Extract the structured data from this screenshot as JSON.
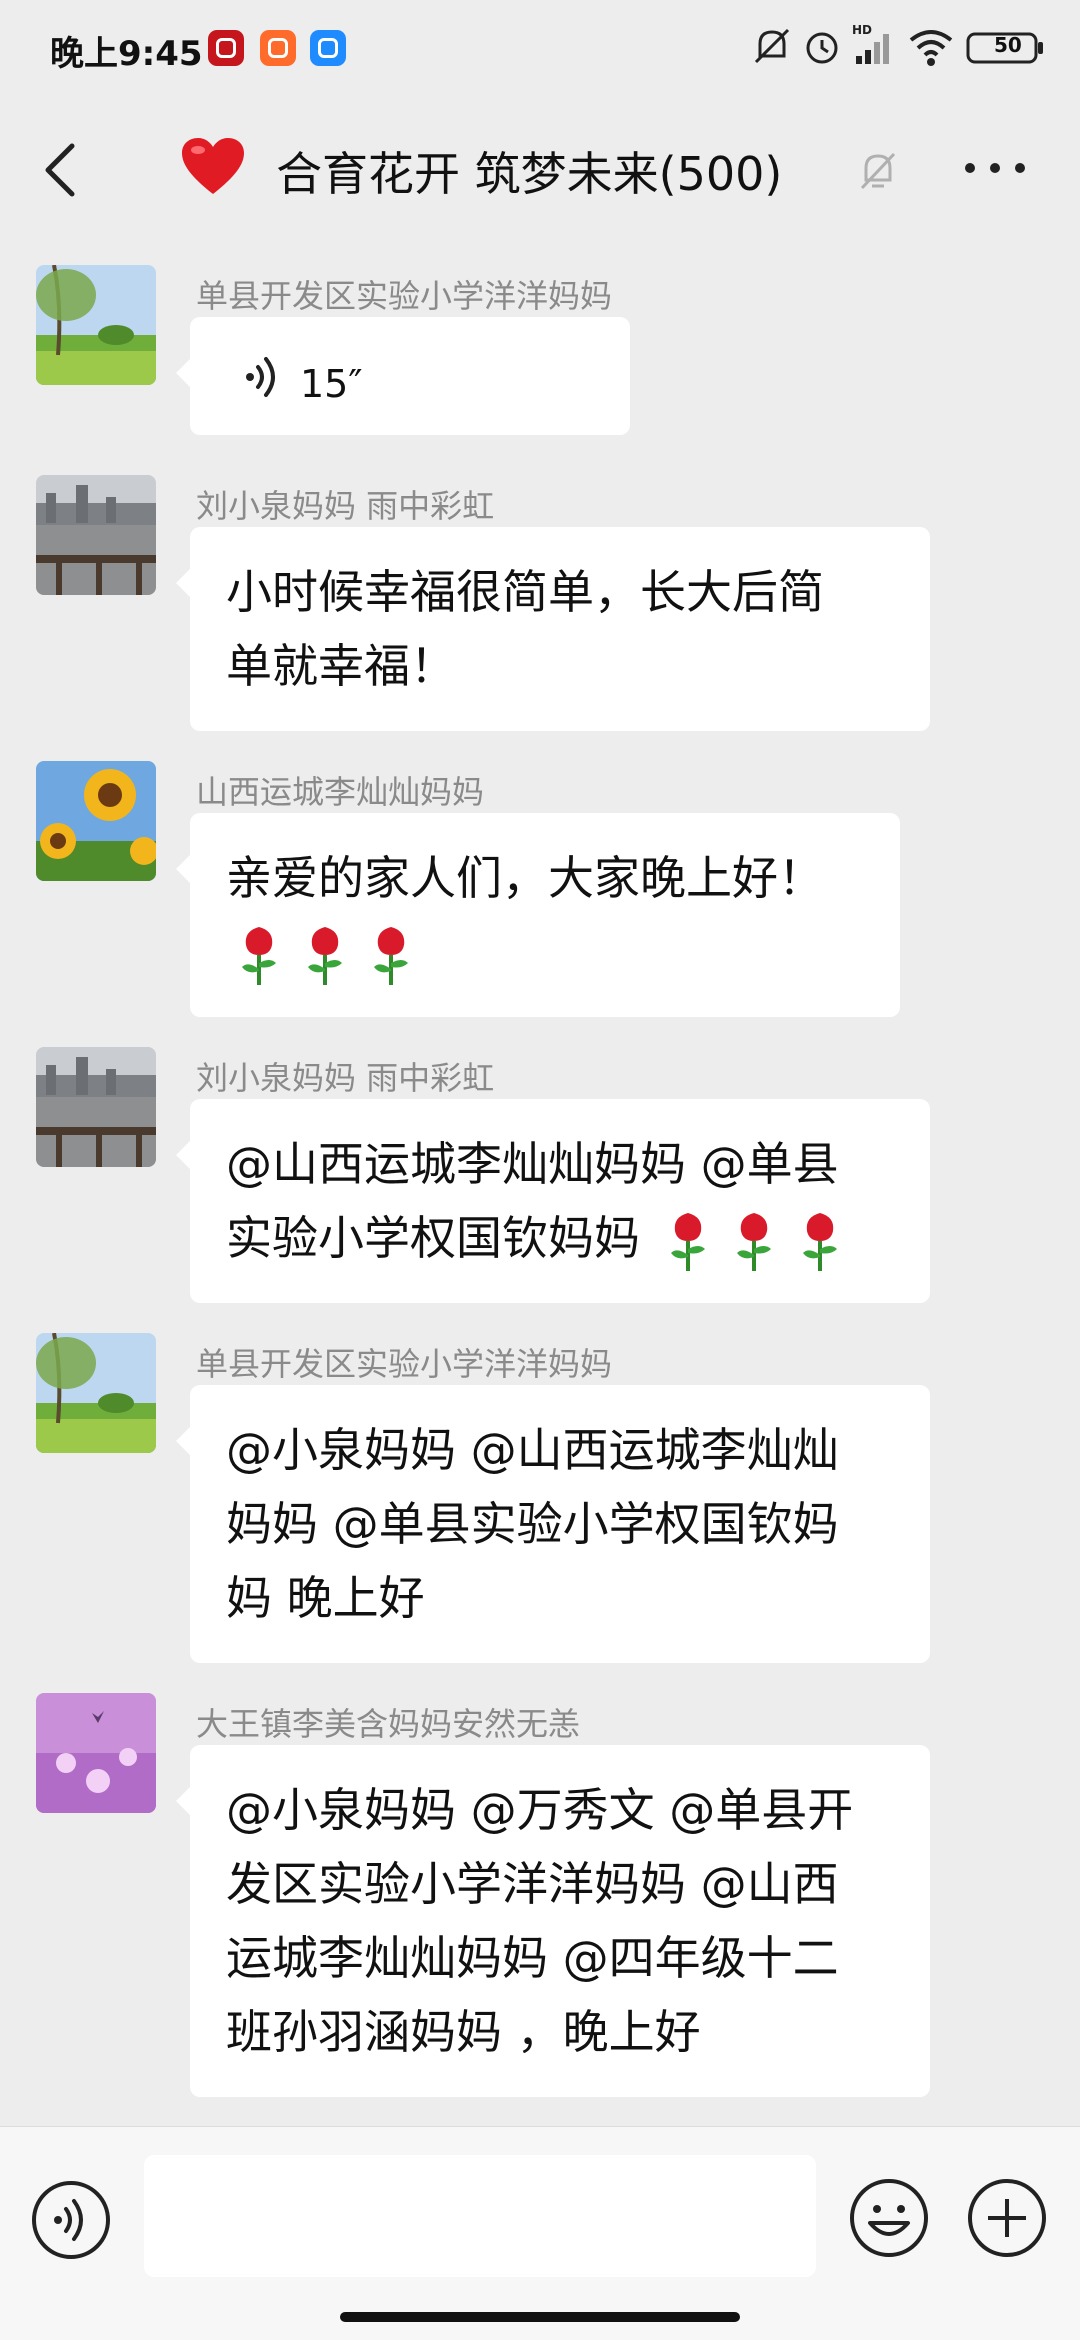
{
  "status_bar": {
    "time": "晚上9:45",
    "battery": "50"
  },
  "header": {
    "title": "合育花开 筑梦未来(500)"
  },
  "messages": [
    {
      "sender": "单县开发区实验小学洋洋妈妈",
      "type": "voice",
      "duration": "15″"
    },
    {
      "sender": "刘小泉妈妈  雨中彩虹",
      "lines": [
        "小时候幸福很简单，长大后简",
        "单就幸福！"
      ]
    },
    {
      "sender": "山西运城李灿灿妈妈",
      "lines": [
        "亲爱的家人们，大家晚上好！"
      ],
      "roses": 3
    },
    {
      "sender": "刘小泉妈妈  雨中彩虹",
      "lines": [
        "@山西运城李灿灿妈妈 @单县",
        "实验小学权国钦妈妈"
      ],
      "roses_inline": 3
    },
    {
      "sender": "单县开发区实验小学洋洋妈妈",
      "lines": [
        "@小泉妈妈 @山西运城李灿灿",
        "妈妈 @单县实验小学权国钦妈",
        "妈  晚上好"
      ]
    },
    {
      "sender": "大王镇李美含妈妈安然无恙",
      "lines": [
        "@小泉妈妈 @万秀文 @单县开",
        "发区实验小学洋洋妈妈 @山西",
        "运城李灿灿妈妈 @四年级十二",
        "班孙羽涵妈妈 ，晚上好"
      ]
    }
  ],
  "icons": {
    "rose": "rose-emoji",
    "heart": "red-heart-emoji"
  }
}
